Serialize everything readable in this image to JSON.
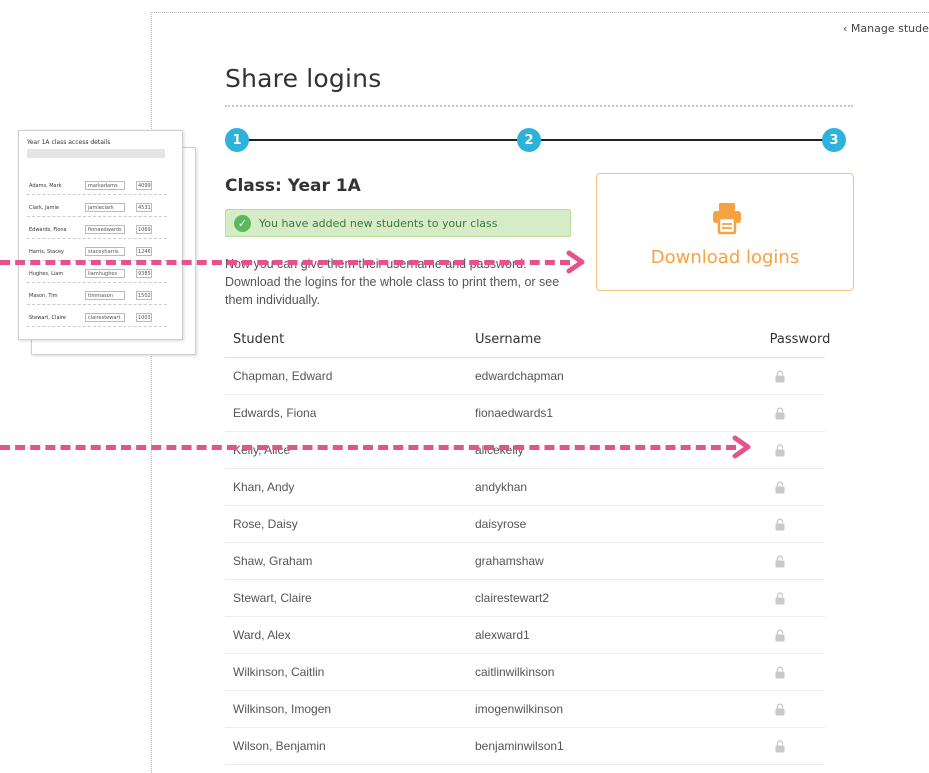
{
  "nav": {
    "back_label": "‹ Manage students"
  },
  "page": {
    "title": "Share logins"
  },
  "steps": [
    {
      "label": "1"
    },
    {
      "label": "2"
    },
    {
      "label": "3"
    }
  ],
  "class_heading": "Class: Year 1A",
  "alert": {
    "text": "You have added new students to your class",
    "color": "#d6ecc7"
  },
  "info": {
    "text": "Now you can give them their username and password. Download the logins for the whole class to print them, or see them individually."
  },
  "download": {
    "label": "Download logins",
    "icon": "printer-icon",
    "accent": "#f5a340"
  },
  "table": {
    "headers": {
      "student": "Student",
      "username": "Username",
      "password": "Password"
    },
    "rows": [
      {
        "student": "Chapman, Edward",
        "username": "edwardchapman"
      },
      {
        "student": "Edwards, Fiona",
        "username": "fionaedwards1"
      },
      {
        "student": "Kelly, Alice",
        "username": "alicekelly"
      },
      {
        "student": "Khan, Andy",
        "username": "andykhan"
      },
      {
        "student": "Rose, Daisy",
        "username": "daisyrose"
      },
      {
        "student": "Shaw, Graham",
        "username": "grahamshaw"
      },
      {
        "student": "Stewart, Claire",
        "username": "clairestewart2"
      },
      {
        "student": "Ward, Alex",
        "username": "alexward1"
      },
      {
        "student": "Wilkinson, Caitlin",
        "username": "caitlinwilkinson"
      },
      {
        "student": "Wilkinson, Imogen",
        "username": "imogenwilkinson"
      },
      {
        "student": "Wilson, Benjamin",
        "username": "benjaminwilson1"
      }
    ]
  },
  "thumbnail": {
    "title": "Year 1A class access details",
    "rows": [
      {
        "name": "Adams, Mark",
        "user": "markadams",
        "pass": "4099"
      },
      {
        "name": "Clark, Jamie",
        "user": "jamieclark",
        "pass": "4531"
      },
      {
        "name": "Edwards, Fiona",
        "user": "fionaedwards",
        "pass": "1069"
      },
      {
        "name": "Harris, Stacey",
        "user": "staceyharris",
        "pass": "1246"
      },
      {
        "name": "Hughes, Liam",
        "user": "liamhughes",
        "pass": "9385"
      },
      {
        "name": "Mason, Tim",
        "user": "timmason",
        "pass": "1502"
      },
      {
        "name": "Stewart, Claire",
        "user": "clairestewart",
        "pass": "1003"
      }
    ]
  },
  "colors": {
    "step": "#2db2dc",
    "annotation_arrow": "#e4548b"
  }
}
